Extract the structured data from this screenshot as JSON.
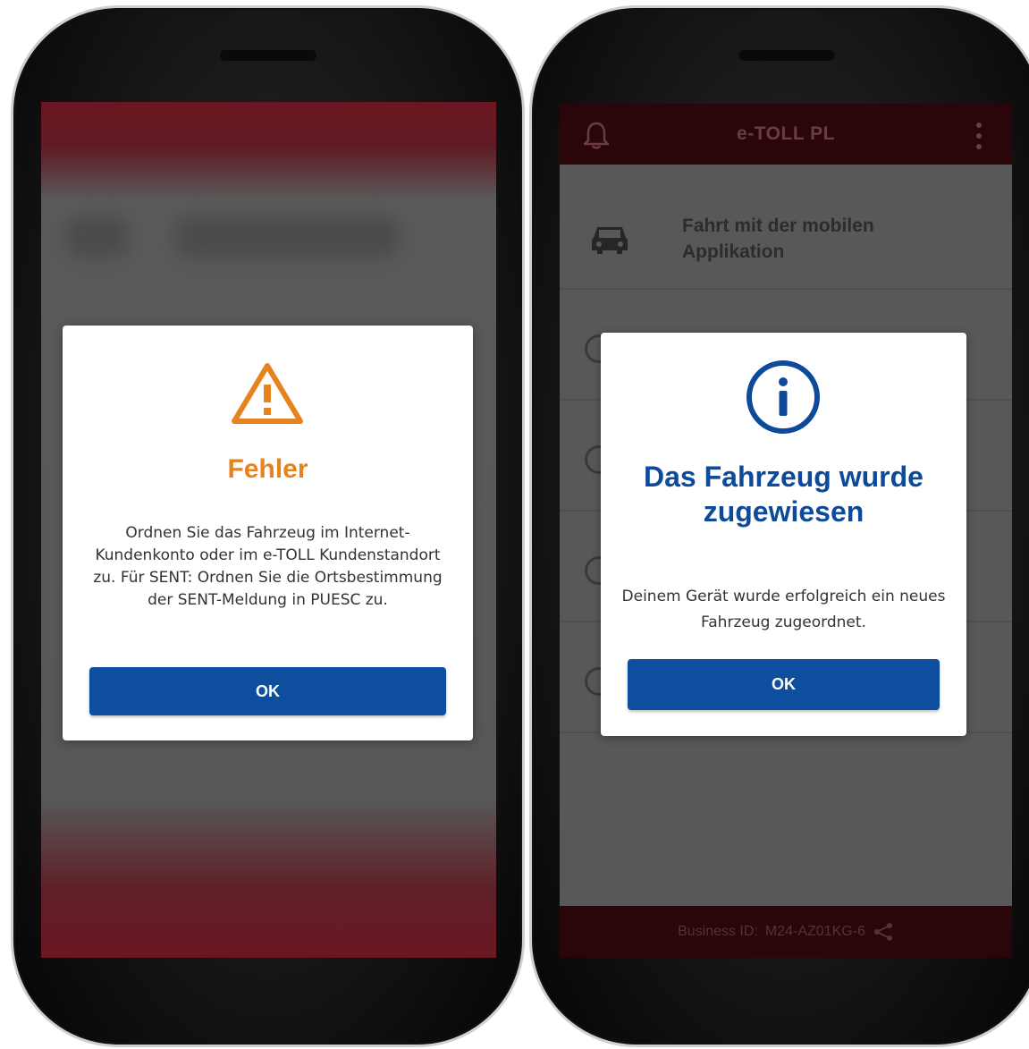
{
  "left_screen": {
    "dialog": {
      "icon": "warning-icon",
      "title": "Fehler",
      "message": "Ordnen Sie das Fahrzeug im Internet-Kundenkonto oder im e-TOLL Kundenstandort zu. Für SENT: Ordnen Sie die Ortsbestimmung der SENT-Meldung in PUESC zu.",
      "button_label": "OK"
    },
    "colors": {
      "title": "#e5831f",
      "button": "#0d4f9e"
    }
  },
  "right_screen": {
    "header": {
      "title": "e-TOLL PL",
      "left_icon": "bell-icon",
      "right_icon": "kebab-menu-icon"
    },
    "list": {
      "first_item": {
        "icon": "car-icon",
        "label": "Fahrt mit der mobilen Applikation"
      }
    },
    "dialog": {
      "icon": "info-icon",
      "title": "Das Fahrzeug wurde zugewiesen",
      "message": "Deinem Gerät wurde erfolgreich ein neues Fahrzeug zugeordnet.",
      "button_label": "OK"
    },
    "footer": {
      "business_id_label": "Business ID:",
      "business_id_value": "M24-AZ01KG-6",
      "share_icon": "share-icon"
    },
    "colors": {
      "title": "#0d4a99",
      "button": "#0d4f9e",
      "header": "#2a0509"
    }
  }
}
